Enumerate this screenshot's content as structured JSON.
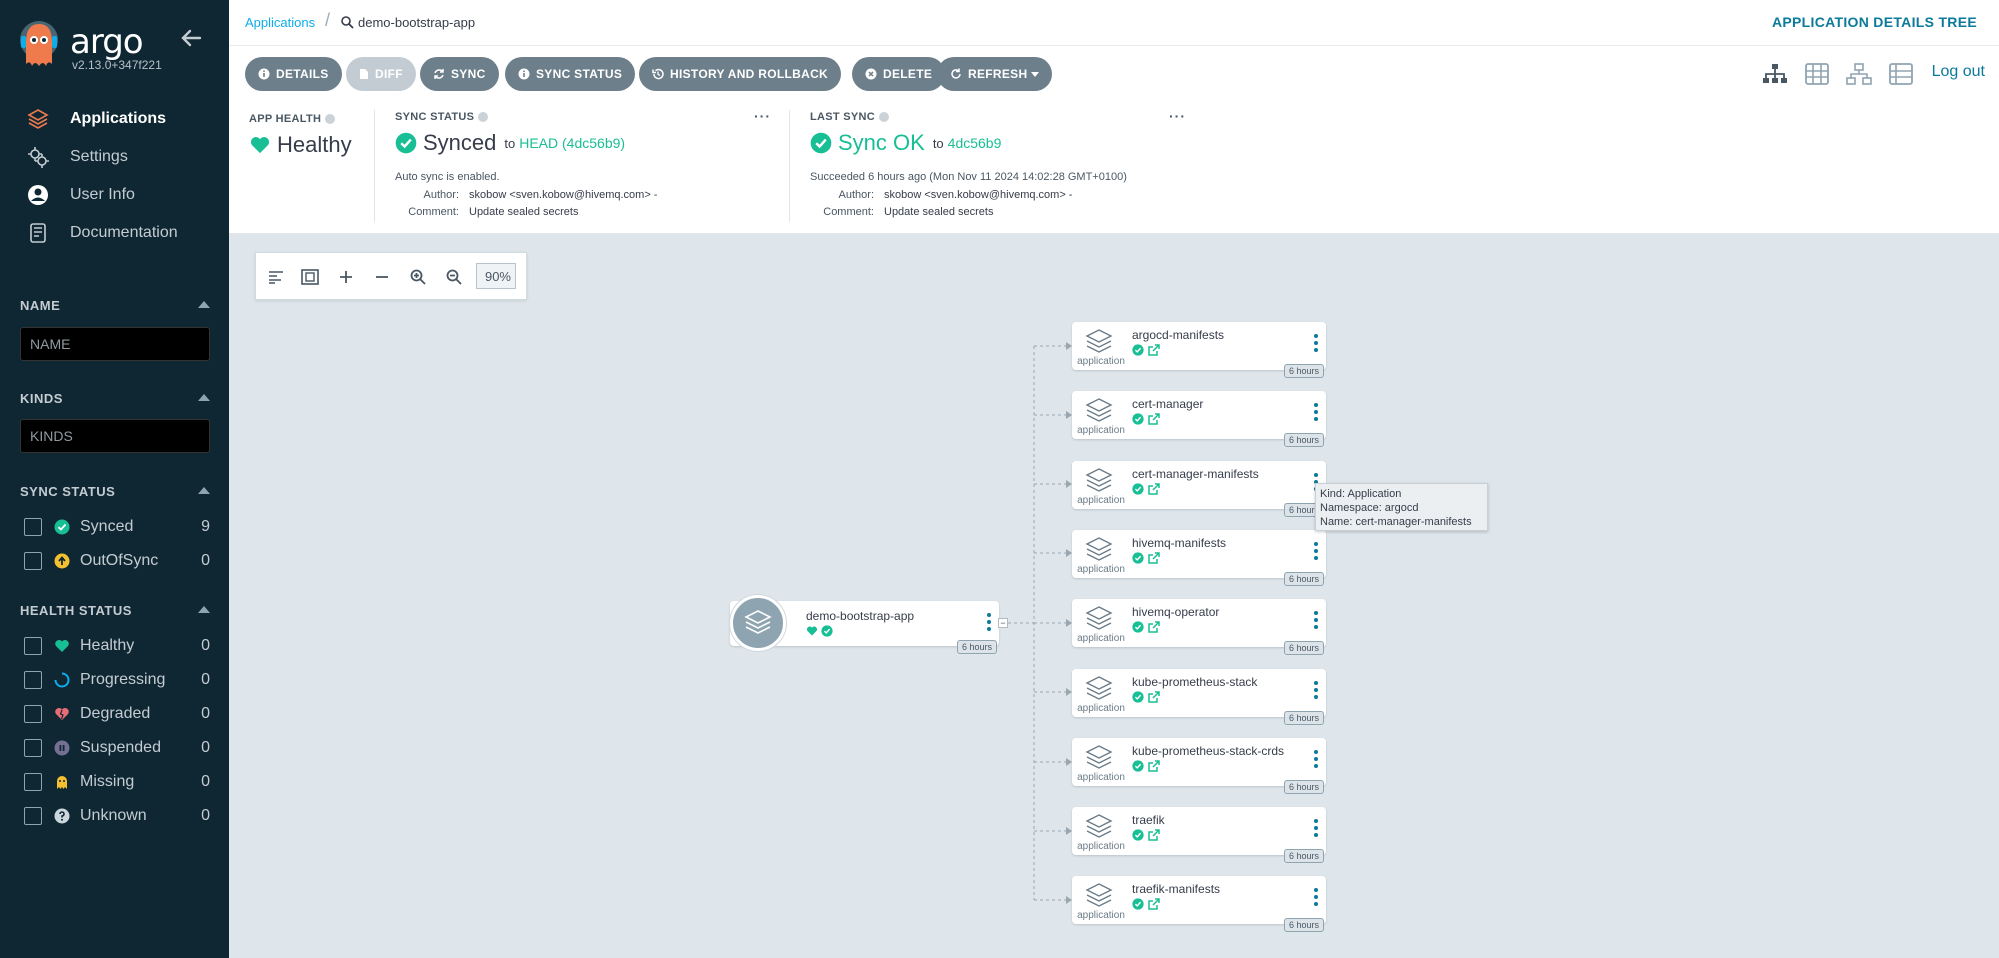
{
  "sidebar": {
    "brand": "argo",
    "version": "v2.13.0+347f221",
    "nav": [
      {
        "label": "Applications",
        "icon": "layers-icon",
        "active": true
      },
      {
        "label": "Settings",
        "icon": "gears-icon"
      },
      {
        "label": "User Info",
        "icon": "user-icon"
      },
      {
        "label": "Documentation",
        "icon": "book-icon"
      }
    ],
    "filters": {
      "name": {
        "title": "NAME",
        "placeholder": "NAME"
      },
      "kinds": {
        "title": "KINDS",
        "placeholder": "KINDS"
      },
      "sync_status": {
        "title": "SYNC STATUS",
        "items": [
          {
            "label": "Synced",
            "count": "9",
            "color": "#18be94"
          },
          {
            "label": "OutOfSync",
            "count": "0",
            "color": "#f4c030"
          }
        ]
      },
      "health_status": {
        "title": "HEALTH STATUS",
        "items": [
          {
            "label": "Healthy",
            "count": "0",
            "color": "#18be94"
          },
          {
            "label": "Progressing",
            "count": "0",
            "color": "#0dadea"
          },
          {
            "label": "Degraded",
            "count": "0",
            "color": "#e96d76"
          },
          {
            "label": "Suspended",
            "count": "0",
            "color": "#766f94"
          },
          {
            "label": "Missing",
            "count": "0",
            "color": "#f4c030"
          },
          {
            "label": "Unknown",
            "count": "0",
            "color": "#ccd6dd"
          }
        ]
      }
    }
  },
  "breadcrumb": {
    "root": "Applications",
    "current": "demo-bootstrap-app"
  },
  "page_heading": "APPLICATION DETAILS TREE",
  "toolbar": {
    "details": "DETAILS",
    "diff": "DIFF",
    "sync": "SYNC",
    "sync_status": "SYNC STATUS",
    "history": "HISTORY AND ROLLBACK",
    "delete": "DELETE",
    "refresh": "REFRESH",
    "logout": "Log out"
  },
  "status": {
    "app_health": {
      "label": "APP HEALTH",
      "value": "Healthy"
    },
    "sync_status": {
      "label": "SYNC STATUS",
      "value": "Synced",
      "to": "to",
      "revision": "HEAD (4dc56b9)",
      "auto_sync": "Auto sync is enabled.",
      "author_key": "Author:",
      "author": "skobow <sven.kobow@hivemq.com> -",
      "comment_key": "Comment:",
      "comment": "Update sealed secrets"
    },
    "last_sync": {
      "label": "LAST SYNC",
      "value": "Sync OK",
      "to": "to",
      "revision": "4dc56b9",
      "succeeded": "Succeeded 6 hours ago (Mon Nov 11 2024 14:02:28 GMT+0100)",
      "author_key": "Author:",
      "author": "skobow <sven.kobow@hivemq.com> -",
      "comment_key": "Comment:",
      "comment": "Update sealed secrets"
    },
    "more": "···"
  },
  "zoom": {
    "level": "90%"
  },
  "tree": {
    "root": {
      "name": "demo-bootstrap-app",
      "age": "6 hours"
    },
    "children": [
      {
        "name": "argocd-manifests",
        "type": "application",
        "age": "6 hours"
      },
      {
        "name": "cert-manager",
        "type": "application",
        "age": "6 hours"
      },
      {
        "name": "cert-manager-manifests",
        "type": "application",
        "age": "6 hours"
      },
      {
        "name": "hivemq-manifests",
        "type": "application",
        "age": "6 hours"
      },
      {
        "name": "hivemq-operator",
        "type": "application",
        "age": "6 hours"
      },
      {
        "name": "kube-prometheus-stack",
        "type": "application",
        "age": "6 hours"
      },
      {
        "name": "kube-prometheus-stack-crds",
        "type": "application",
        "age": "6 hours"
      },
      {
        "name": "traefik",
        "type": "application",
        "age": "6 hours"
      },
      {
        "name": "traefik-manifests",
        "type": "application",
        "age": "6 hours"
      }
    ]
  },
  "tooltip": {
    "kind": "Kind: Application",
    "namespace": "Namespace: argocd",
    "name": "Name: cert-manager-manifests"
  },
  "colors": {
    "accent": "#0dadea",
    "healthy": "#18be94",
    "sidebar": "#0f2733"
  }
}
